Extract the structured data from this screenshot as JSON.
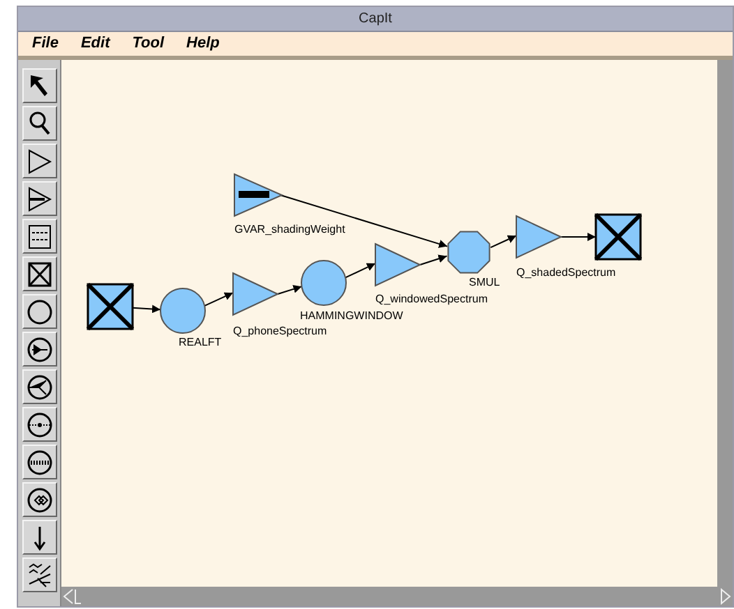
{
  "window": {
    "title": "CapIt"
  },
  "menu": [
    "File",
    "Edit",
    "Tool",
    "Help"
  ],
  "tools": [
    {
      "kind": "pointer"
    },
    {
      "kind": "zoom"
    },
    {
      "kind": "triangle"
    },
    {
      "kind": "bar-triangle"
    },
    {
      "kind": "graph"
    },
    {
      "kind": "cross-box"
    },
    {
      "kind": "circle"
    },
    {
      "kind": "circle-arrow"
    },
    {
      "kind": "circle-fork"
    },
    {
      "kind": "circle-dots"
    },
    {
      "kind": "circle-bar"
    },
    {
      "kind": "circle-diamond"
    },
    {
      "kind": "down-arrow"
    },
    {
      "kind": "pattern"
    }
  ],
  "nodes": [
    {
      "kind": "source"
    },
    {
      "kind": "circle",
      "label": "REALFT"
    },
    {
      "kind": "triangle",
      "label": "Q_phoneSpectrum"
    },
    {
      "kind": "circle",
      "label": "HAMMINGWINDOW"
    },
    {
      "kind": "triangle",
      "label": "Q_windowedSpectrum"
    },
    {
      "kind": "variable",
      "label": "GVAR_shadingWeight"
    },
    {
      "kind": "octagon",
      "label": "SMUL"
    },
    {
      "kind": "triangle",
      "label": "Q_shadedSpectrum"
    },
    {
      "kind": "sink"
    }
  ]
}
